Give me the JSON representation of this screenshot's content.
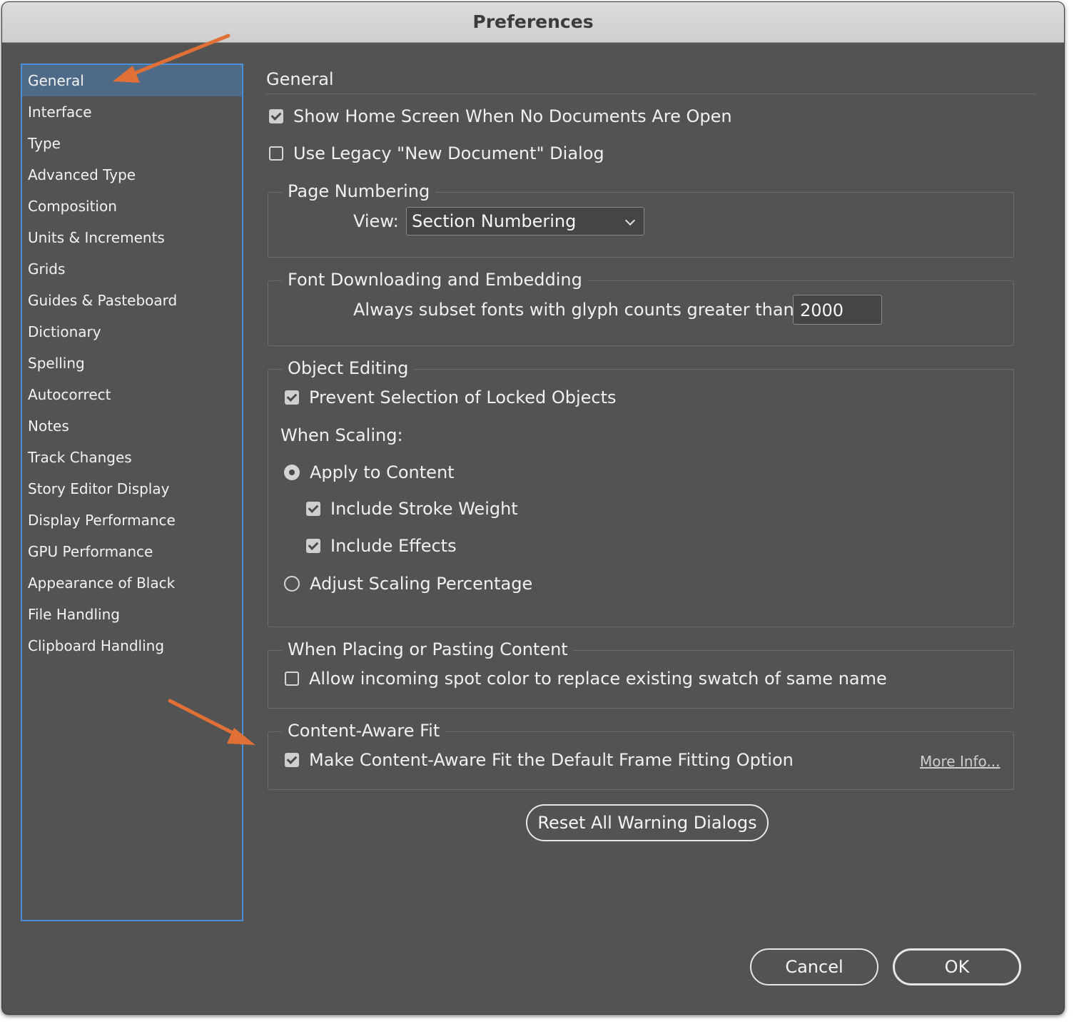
{
  "window": {
    "title": "Preferences"
  },
  "sidebar": {
    "items": [
      {
        "label": "General",
        "selected": true
      },
      {
        "label": "Interface"
      },
      {
        "label": "Type"
      },
      {
        "label": "Advanced Type"
      },
      {
        "label": "Composition"
      },
      {
        "label": "Units & Increments"
      },
      {
        "label": "Grids"
      },
      {
        "label": "Guides & Pasteboard"
      },
      {
        "label": "Dictionary"
      },
      {
        "label": "Spelling"
      },
      {
        "label": "Autocorrect"
      },
      {
        "label": "Notes"
      },
      {
        "label": "Track Changes"
      },
      {
        "label": "Story Editor Display"
      },
      {
        "label": "Display Performance"
      },
      {
        "label": "GPU Performance"
      },
      {
        "label": "Appearance of Black"
      },
      {
        "label": "File Handling"
      },
      {
        "label": "Clipboard Handling"
      }
    ]
  },
  "panel": {
    "title": "General",
    "show_home_screen": {
      "label": "Show Home Screen When No Documents Are Open",
      "checked": true
    },
    "legacy_dialog": {
      "label": "Use Legacy \"New Document\" Dialog",
      "checked": false
    },
    "page_numbering": {
      "legend": "Page Numbering",
      "view_label": "View:",
      "view_value": "Section Numbering"
    },
    "font_downloading": {
      "legend": "Font Downloading and Embedding",
      "subset_label": "Always subset fonts with glyph counts greater than:",
      "subset_value": "2000"
    },
    "object_editing": {
      "legend": "Object Editing",
      "prevent_selection": {
        "label": "Prevent Selection of Locked Objects",
        "checked": true
      },
      "when_scaling": "When Scaling:",
      "apply_to_content": {
        "label": "Apply to Content",
        "selected": true
      },
      "include_stroke": {
        "label": "Include Stroke Weight",
        "checked": true
      },
      "include_effects": {
        "label": "Include Effects",
        "checked": true
      },
      "adjust_scaling": {
        "label": "Adjust Scaling Percentage",
        "selected": false
      }
    },
    "placing_pasting": {
      "legend": "When Placing or Pasting Content",
      "spot_color": {
        "label": "Allow incoming spot color to replace existing swatch of same name",
        "checked": false
      }
    },
    "content_aware": {
      "legend": "Content-Aware Fit",
      "default_fitting": {
        "label": "Make Content-Aware Fit the Default Frame Fitting Option",
        "checked": true
      },
      "more_info": "More Info..."
    },
    "reset_warnings": "Reset All Warning Dialogs"
  },
  "footer": {
    "cancel": "Cancel",
    "ok": "OK"
  },
  "colors": {
    "window_bg": "#535353",
    "sidebar_border": "#4a90d9",
    "selected_item": "#4f6a86",
    "annotation_arrow": "#e07035"
  }
}
